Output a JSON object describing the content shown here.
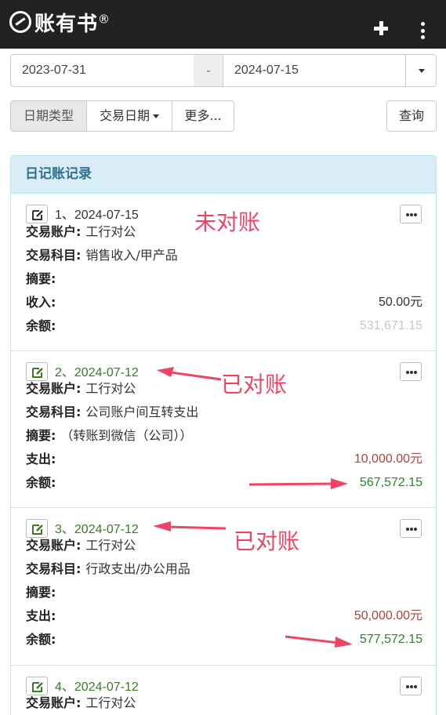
{
  "app": {
    "name": "账有书",
    "reg": "®"
  },
  "filters": {
    "start_date": "2023-07-31",
    "separator": "-",
    "end_date": "2024-07-15",
    "date_type_label": "日期类型",
    "trade_date_label": "交易日期",
    "more_label": "更多...",
    "query_label": "查询"
  },
  "panel": {
    "title": "日记账记录"
  },
  "labels": {
    "account": "交易账户:",
    "subject": "交易科目:",
    "summary": "摘要:",
    "income": "收入:",
    "expense": "支出:",
    "balance": "余额:"
  },
  "entries": [
    {
      "head": "1、2024-07-15",
      "account": "工行对公",
      "subject": "销售收入/甲产品",
      "summary": "",
      "amount": "50.00元",
      "balance": "531,671.15"
    },
    {
      "head": "2、2024-07-12",
      "account": "工行对公",
      "subject": "公司账户间互转支出",
      "summary": "（转账到微信（公司））",
      "amount": "10,000.00元",
      "balance": "567,572.15"
    },
    {
      "head": "3、2024-07-12",
      "account": "工行对公",
      "subject": "行政支出/办公用品",
      "summary": "",
      "amount": "50,000.00元",
      "balance": "577,572.15"
    },
    {
      "head": "4、2024-07-12",
      "account": "工行对公"
    }
  ],
  "annotations": {
    "unreconciled": "未对账",
    "reconciled": "已对账"
  },
  "colors": {
    "annotation": "#ef4565",
    "panel_title": "#31708f",
    "reconciled_date": "#3a7a28",
    "balance_green": "#228a22",
    "expense_red": "#a94442"
  }
}
